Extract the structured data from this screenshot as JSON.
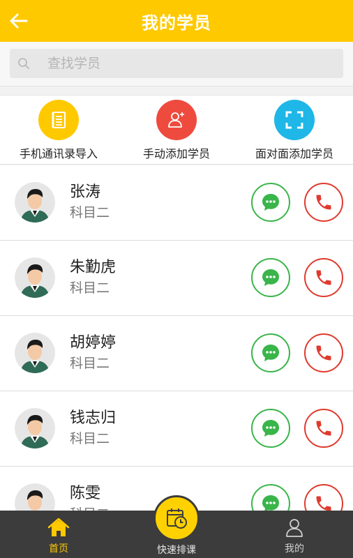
{
  "header": {
    "title": "我的学员"
  },
  "search": {
    "placeholder": "查找学员"
  },
  "actions": [
    {
      "label": "手机通讯录导入",
      "icon": "contacts-book-icon",
      "color": "#FFC900"
    },
    {
      "label": "手动添加学员",
      "icon": "add-user-icon",
      "color": "#EE4B3E"
    },
    {
      "label": "面对面添加学员",
      "icon": "scan-frame-icon",
      "color": "#1EB7E8"
    }
  ],
  "students": [
    {
      "name": "张涛",
      "subject": "科目二"
    },
    {
      "name": "朱勤虎",
      "subject": "科目二"
    },
    {
      "name": "胡婷婷",
      "subject": "科目二"
    },
    {
      "name": "钱志归",
      "subject": "科目二"
    },
    {
      "name": "陈雯",
      "subject": "科目二"
    }
  ],
  "tabbar": {
    "home": {
      "label": "首页",
      "icon": "home-icon"
    },
    "schedule": {
      "label": "快速排课",
      "icon": "calendar-clock-icon"
    },
    "mine": {
      "label": "我的",
      "icon": "user-icon"
    }
  },
  "colors": {
    "primary": "#FFC900",
    "message": "#39B54A",
    "call": "#E03A2E",
    "tabbar": "#3c3c3c"
  }
}
